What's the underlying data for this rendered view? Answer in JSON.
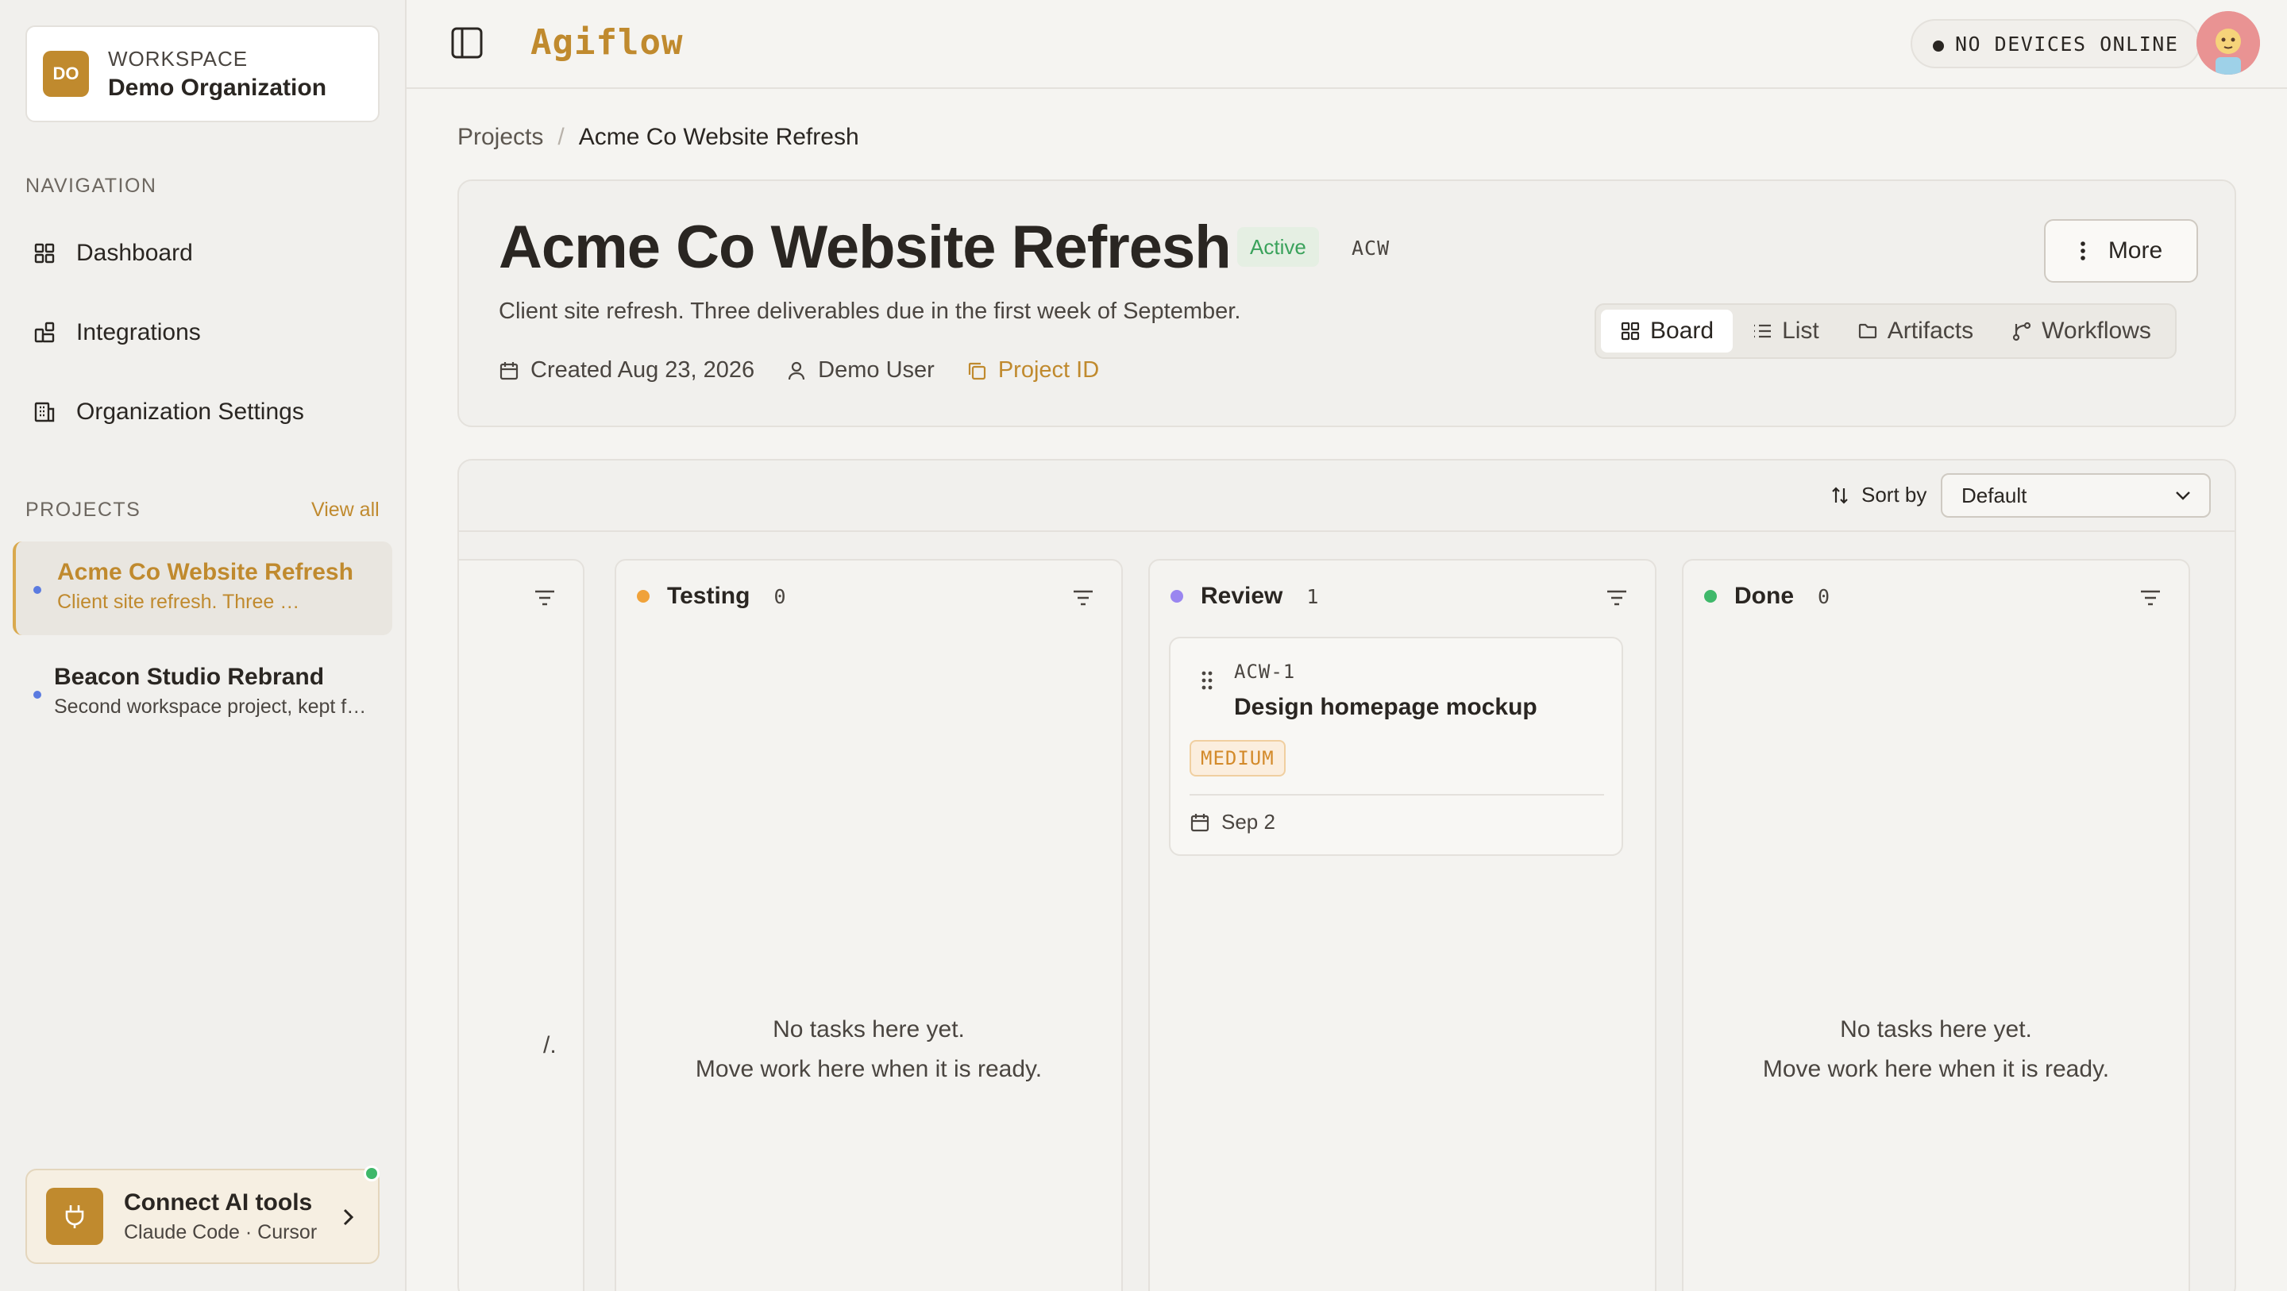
{
  "workspace": {
    "initials": "DO",
    "label": "WORKSPACE",
    "name": "Demo Organization"
  },
  "nav": {
    "heading": "NAVIGATION",
    "items": [
      {
        "label": "Dashboard",
        "icon": "grid-icon"
      },
      {
        "label": "Integrations",
        "icon": "blocks-icon"
      },
      {
        "label": "Organization Settings",
        "icon": "building-icon"
      }
    ]
  },
  "projects": {
    "heading": "PROJECTS",
    "view_all": "View all",
    "items": [
      {
        "title": "Acme Co Website Refresh",
        "subtitle": "Client site refresh. Three deliverables due in the first week of September.",
        "active": true
      },
      {
        "title": "Beacon Studio Rebrand",
        "subtitle": "Second workspace project, kept for switching.",
        "active": false
      }
    ]
  },
  "connect": {
    "title": "Connect AI tools",
    "subtitle": "Claude Code · Cursor"
  },
  "topbar": {
    "brand": "Agiflow",
    "devices": "NO DEVICES ONLINE"
  },
  "breadcrumb": {
    "root": "Projects",
    "separator": "/",
    "current": "Acme Co Website Refresh"
  },
  "project": {
    "title": "Acme Co Website Refresh",
    "status": "Active",
    "key": "ACW",
    "description": "Client site refresh. Three deliverables due in the first week of September.",
    "created": "Created Aug 23, 2026",
    "owner": "Demo User",
    "project_id_label": "Project ID",
    "more_label": "More"
  },
  "views": {
    "board": "Board",
    "list": "List",
    "artifacts": "Artifacts",
    "workflows": "Workflows",
    "active": "Board"
  },
  "board": {
    "sort_label": "Sort by",
    "sort_value": "Default",
    "partial_column_text": "/.",
    "columns": [
      {
        "name": "Testing",
        "count": "0",
        "color": "#f0a23a",
        "empty_line1": "No tasks here yet.",
        "empty_line2": "Move work here when it is ready."
      },
      {
        "name": "Review",
        "count": "1",
        "color": "#9a86f0"
      },
      {
        "name": "Done",
        "count": "0",
        "color": "#3fb86a",
        "empty_line1": "No tasks here yet.",
        "empty_line2": "Move work here when it is ready."
      }
    ],
    "task": {
      "key": "ACW-1",
      "title": "Design homepage mockup",
      "priority": "MEDIUM",
      "due": "Sep 2"
    }
  },
  "colors": {
    "accent": "#c08a2e",
    "active_green": "#3aa25b"
  }
}
